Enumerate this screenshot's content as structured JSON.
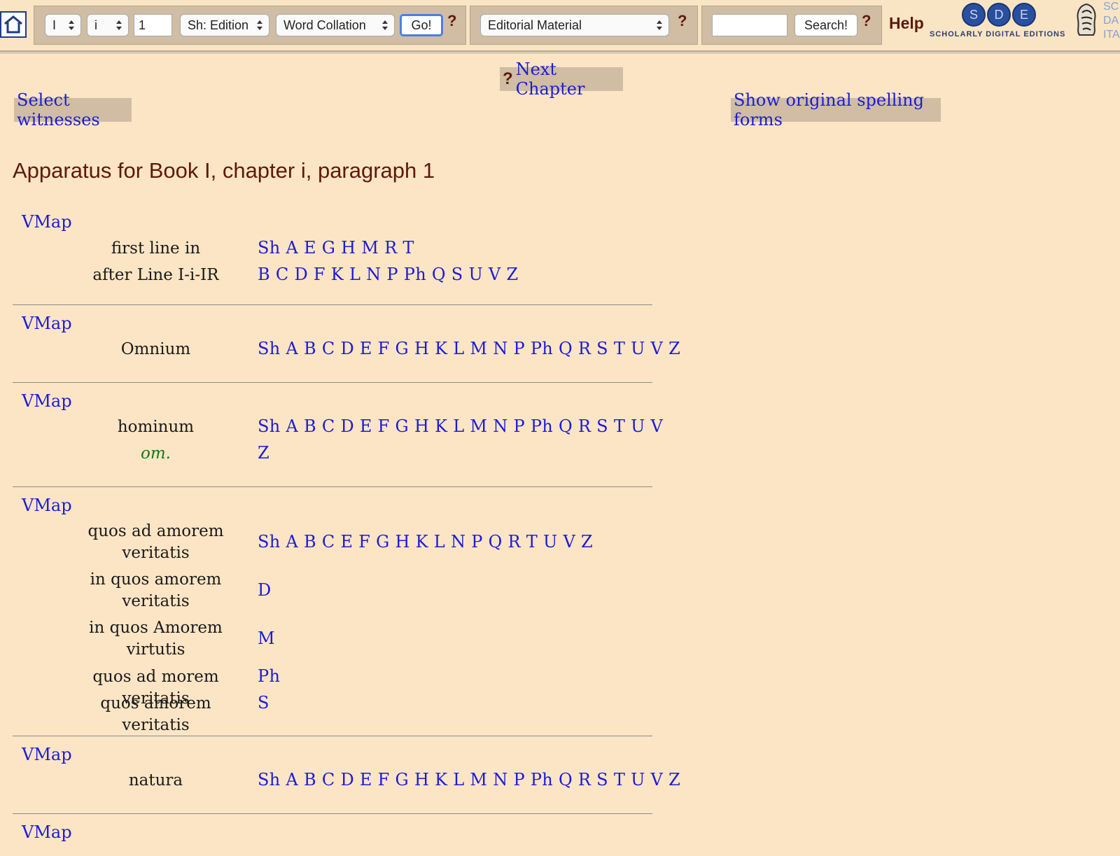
{
  "toolbar": {
    "book_select": "I",
    "chapter_select": "i",
    "paragraph_input": "1",
    "view_select": "Sh: Edition",
    "mode_select": "Word Collation",
    "go_label": "Go!",
    "help_mark": "?",
    "editorial_select": "Editorial Material",
    "search_value": "",
    "search_label": "Search!",
    "help_label": "Help",
    "logo_letters": [
      "S",
      "D",
      "E"
    ],
    "logo_text": "SCHOLARLY DIGITAL EDITIONS",
    "partner_text": [
      "SC",
      "DA",
      "ITA"
    ]
  },
  "nav": {
    "help_mark": "?",
    "next_chapter": "Next Chapter",
    "select_witnesses": "Select witnesses",
    "show_spelling": "Show original spelling forms"
  },
  "page_title": "Apparatus for Book I, chapter i, paragraph 1",
  "apparatus": {
    "vmap_label": "VMap",
    "entries": [
      {
        "readings": [
          {
            "lemma": [
              "first line in"
            ],
            "witnesses": "Sh A E G H M R T"
          },
          {
            "lemma": [
              "after Line I-i-IR"
            ],
            "witnesses": "B C D F K L N P Ph Q S U V Z"
          }
        ]
      },
      {
        "readings": [
          {
            "lemma": [
              "Omnium"
            ],
            "witnesses": "Sh A B C D E F G H K L M N P Ph Q R S T U V Z"
          }
        ]
      },
      {
        "readings": [
          {
            "lemma": [
              "hominum"
            ],
            "witnesses": "Sh A B C D E F G H K L M N P Ph Q R S T U V"
          },
          {
            "lemma": [
              "om."
            ],
            "witnesses": "Z",
            "omission": true
          }
        ]
      },
      {
        "readings": [
          {
            "lemma": [
              "quos ad amorem",
              "veritatis"
            ],
            "witnesses": "Sh A B C E F G H K L N P Q R T U V Z"
          },
          {
            "lemma": [
              "in quos amorem",
              "veritatis"
            ],
            "witnesses": "D"
          },
          {
            "lemma": [
              "in quos Amorem",
              "virtutis"
            ],
            "witnesses": "M"
          },
          {
            "lemma": [
              "quos ad morem veritatis"
            ],
            "witnesses": "Ph"
          },
          {
            "lemma": [
              "quos amorem veritatis"
            ],
            "witnesses": "S"
          }
        ]
      },
      {
        "readings": [
          {
            "lemma": [
              "natura"
            ],
            "witnesses": "Sh A B C D E F G H K L M N P Ph Q R S T U V Z"
          }
        ]
      }
    ]
  }
}
